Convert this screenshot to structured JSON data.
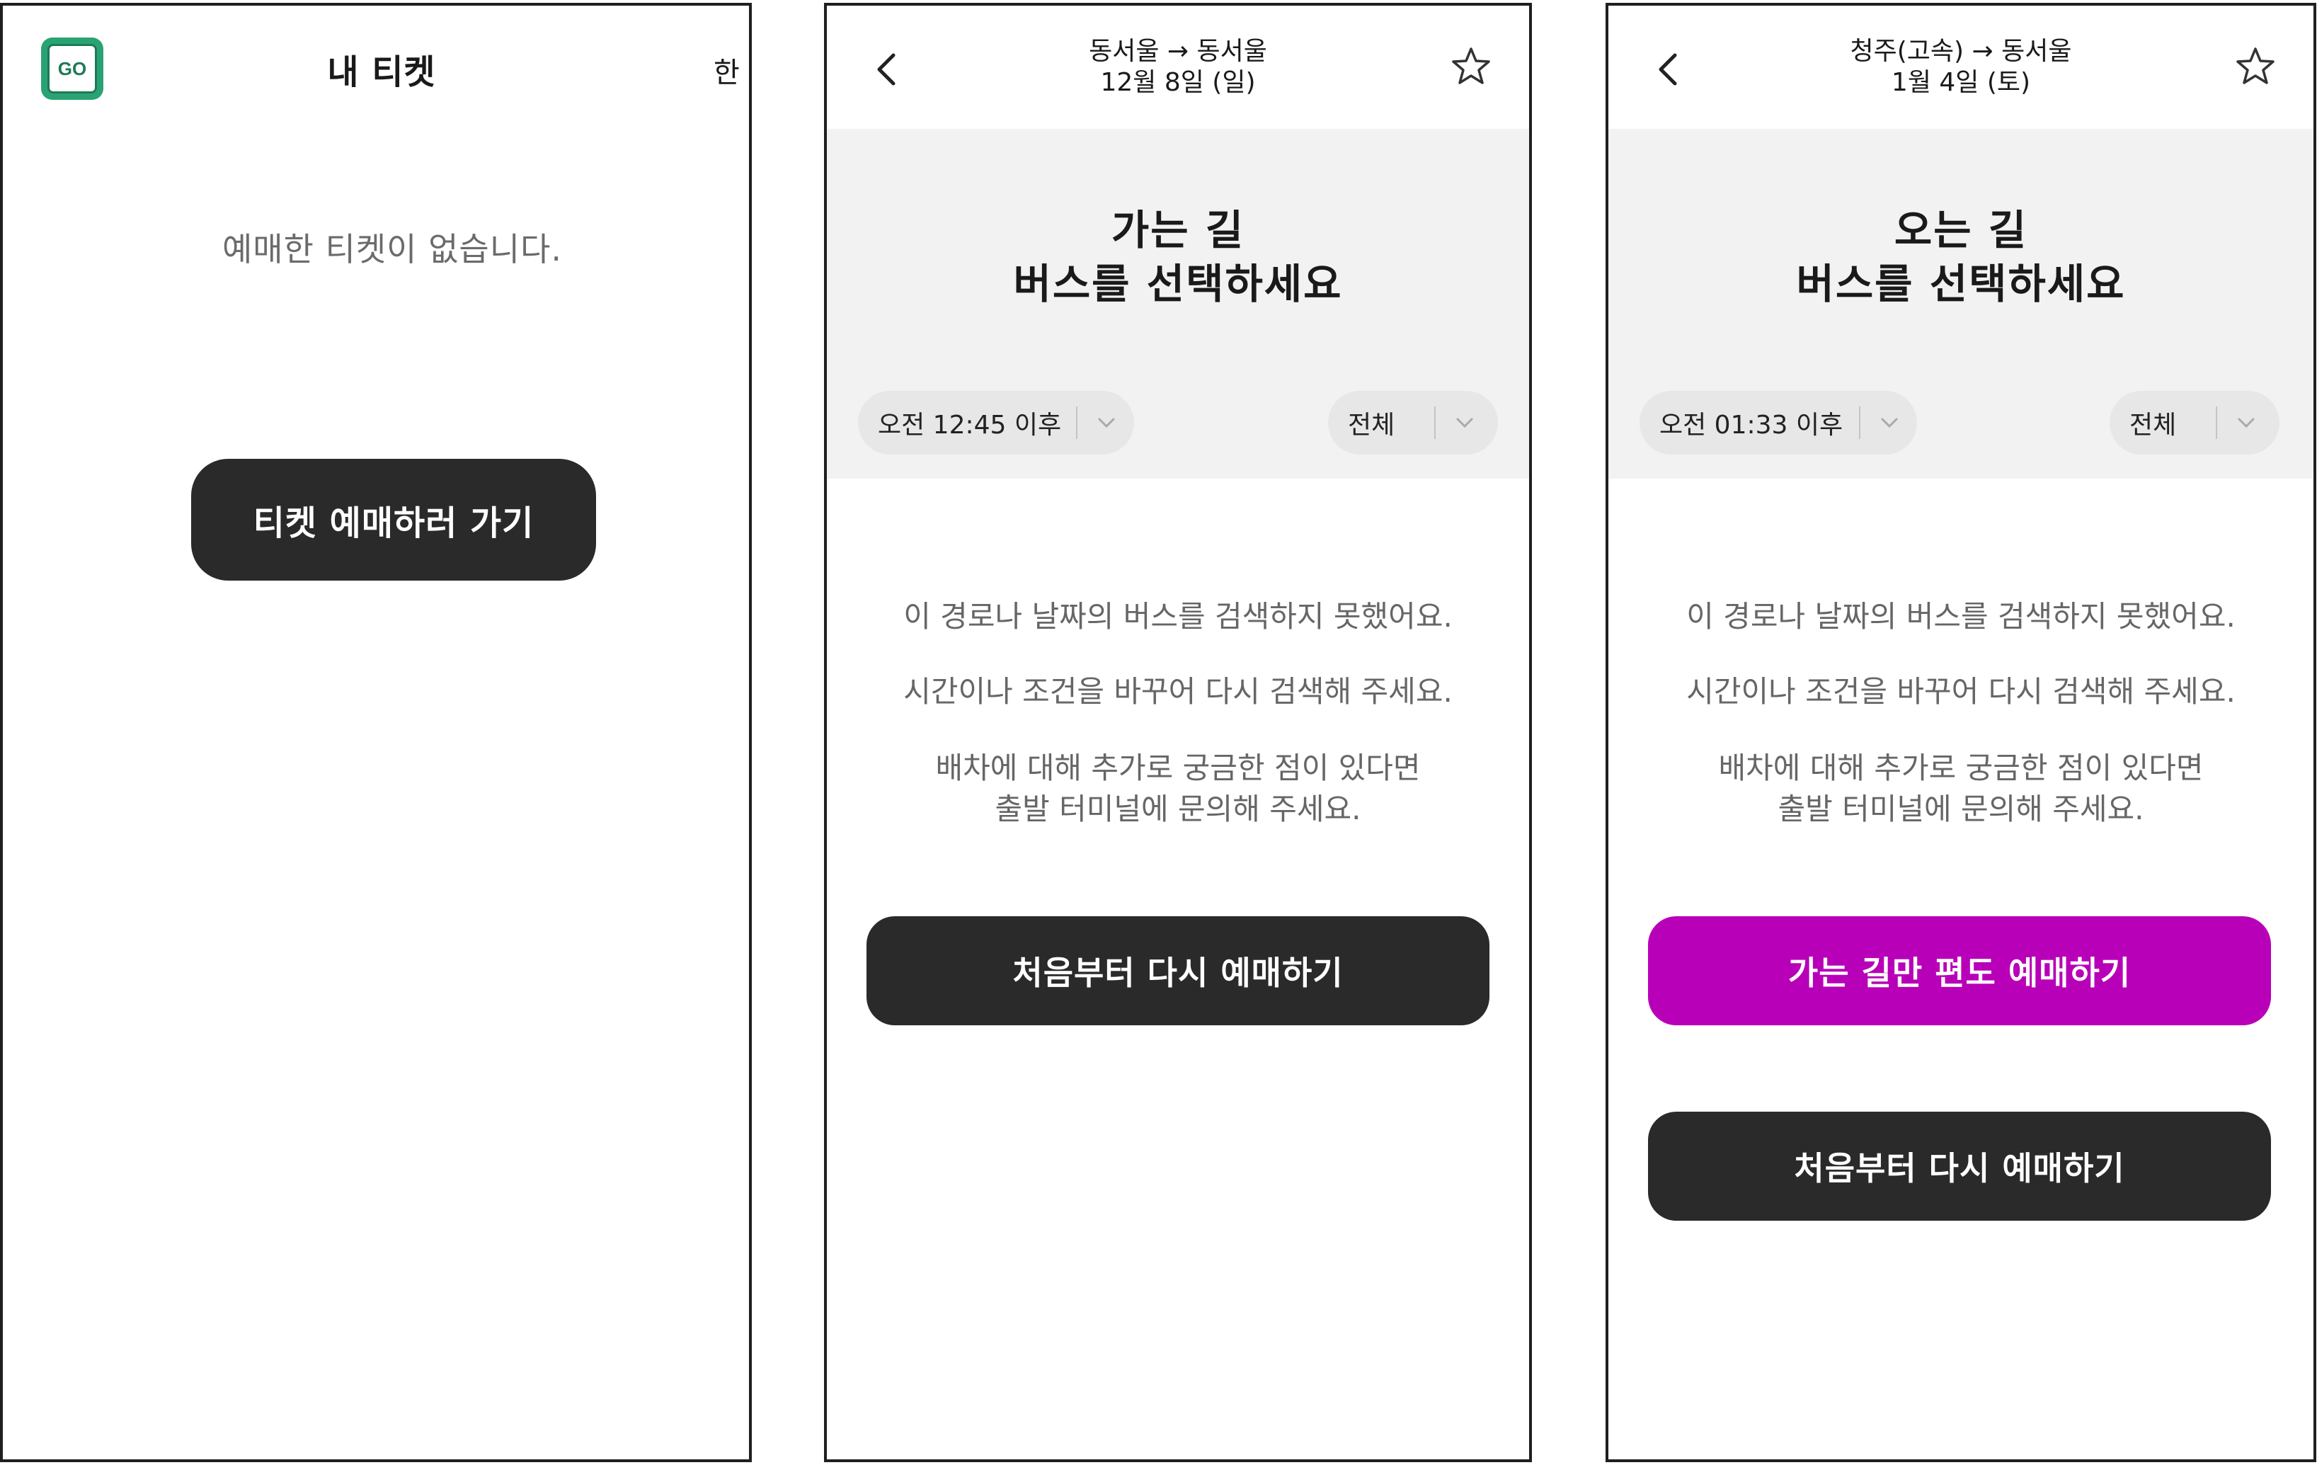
{
  "screen1": {
    "title": "내 티켓",
    "lang_toggle": "한",
    "logo_text": "GO",
    "logo_small_text": "",
    "empty_message": "예매한 티켓이 없습니다.",
    "book_button": "티켓 예매하러 가기"
  },
  "screen2": {
    "route": "동서울 → 동서울",
    "date": "12월 8일 (일)",
    "panel_title_line1": "가는 길",
    "panel_title_line2": "버스를 선택하세요",
    "time_filter": "오전 12:45 이후",
    "class_filter": "전체",
    "msg1": "이 경로나 날짜의 버스를 검색하지 못했어요.",
    "msg2": "시간이나 조건을 바꾸어 다시 검색해 주세요.",
    "msg3_line1": "배차에 대해 추가로 궁금한 점이 있다면",
    "msg3_line2": "출발 터미널에 문의해 주세요.",
    "restart_button": "처음부터 다시 예매하기"
  },
  "screen3": {
    "route": "청주(고속) → 동서울",
    "date": "1월 4일 (토)",
    "panel_title_line1": "오는 길",
    "panel_title_line2": "버스를 선택하세요",
    "time_filter": "오전 01:33 이후",
    "class_filter": "전체",
    "msg1": "이 경로나 날짜의 버스를 검색하지 못했어요.",
    "msg2": "시간이나 조건을 바꾸어 다시 검색해 주세요.",
    "msg3_line1": "배차에 대해 추가로 궁금한 점이 있다면",
    "msg3_line2": "출발 터미널에 문의해 주세요.",
    "oneway_button": "가는 길만 편도 예매하기",
    "restart_button": "처음부터 다시 예매하기"
  },
  "icons": {
    "back": "chevron-left-icon",
    "favorite": "star-outline-icon",
    "dropdown": "chevron-down-icon"
  },
  "colors": {
    "primary_dark": "#2a2a2a",
    "accent_magenta": "#b800b8",
    "panel_gray": "#f2f2f2",
    "logo_green": "#2aa374"
  }
}
